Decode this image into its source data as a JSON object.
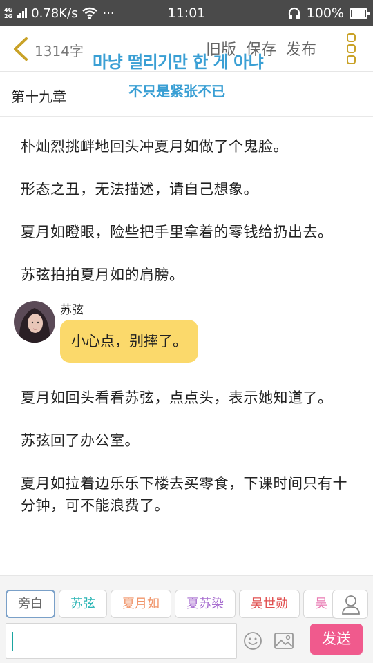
{
  "status_bar": {
    "net_type_top": "4G",
    "net_type_bottom": "2G",
    "speed": "0.78K/s",
    "more": "···",
    "time": "11:01",
    "battery": "100%",
    "battery_level": 1.0
  },
  "header": {
    "word_count": "1314字",
    "old_version": "旧版",
    "save": "保存",
    "publish": "发布"
  },
  "overlay": {
    "korean_caption": "마냥 떨리기만 한 게 아냐",
    "chinese_caption": "不只是紧张不已"
  },
  "chapter": {
    "title": "第十九章"
  },
  "content": {
    "paragraphs": [
      "朴灿烈挑衅地回头冲夏月如做了个鬼脸。",
      "形态之丑，无法描述，请自己想象。",
      "夏月如瞪眼，险些把手里拿着的零钱给扔出去。",
      "苏弦拍拍夏月如的肩膀。",
      "夏月如回头看看苏弦，点点头，表示她知道了。",
      "苏弦回了办公室。",
      "夏月如拉着边乐乐下楼去买零食，下课时间只有十分钟，可不能浪费了。"
    ],
    "dialog": {
      "speaker": "苏弦",
      "text": "小心点，别摔了。"
    }
  },
  "bottom_bar": {
    "characters": [
      {
        "label": "旁白",
        "color": "#666666",
        "active": true
      },
      {
        "label": "苏弦",
        "color": "#2bb5b5",
        "active": false
      },
      {
        "label": "夏月如",
        "color": "#f0956a",
        "active": false
      },
      {
        "label": "夏苏染",
        "color": "#a86fd0",
        "active": false
      },
      {
        "label": "吴世勋",
        "color": "#e05050",
        "active": false
      },
      {
        "label": "吴",
        "color": "#e97ab3",
        "active": false
      }
    ],
    "input_value": "",
    "send_label": "发送"
  },
  "colors": {
    "accent_gold": "#c9a227",
    "bubble": "#fbd96b",
    "send": "#f05a8d",
    "overlay_text": "#3a9fd4"
  }
}
